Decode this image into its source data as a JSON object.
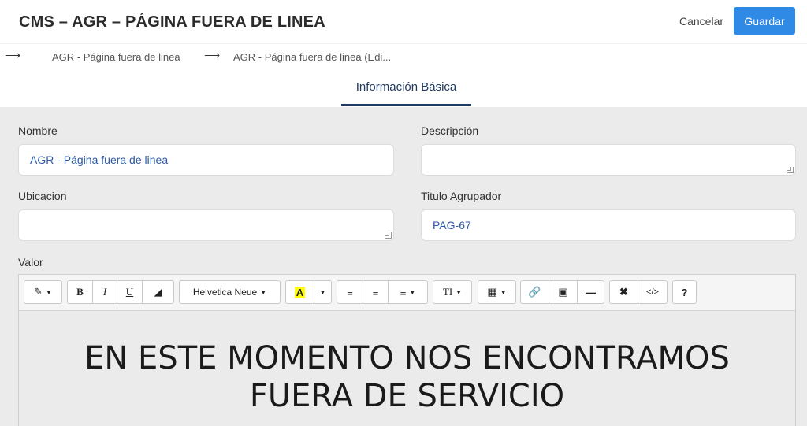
{
  "header": {
    "title": "CMS – AGR – PÁGINA FUERA DE LINEA",
    "cancel_label": "Cancelar",
    "save_label": "Guardar"
  },
  "breadcrumb": {
    "items": [
      "AGR - Página fuera de linea",
      "AGR - Página fuera de linea (Edi..."
    ],
    "separator_icon": "arrow-right-icon"
  },
  "tabs": [
    {
      "label": "Información Básica",
      "active": true
    }
  ],
  "form": {
    "nombre": {
      "label": "Nombre",
      "value": "AGR - Página fuera de linea"
    },
    "descripcion": {
      "label": "Descripción",
      "value": ""
    },
    "ubicacion": {
      "label": "Ubicacion",
      "value": ""
    },
    "titulo_agrupador": {
      "label": "Titulo Agrupador",
      "value": "PAG-67"
    },
    "valor": {
      "label": "Valor"
    }
  },
  "editor": {
    "font_name": "Helvetica Neue",
    "content_lines": [
      "EN ESTE MOMENTO NOS ENCONTRAMOS",
      "FUERA DE SERVICIO"
    ],
    "toolbar_icons": [
      "magic-wand-icon",
      "bold-icon",
      "italic-icon",
      "underline-icon",
      "eraser-icon",
      "font-family-dropdown",
      "highlight-color-icon",
      "unordered-list-icon",
      "ordered-list-icon",
      "align-icon",
      "text-height-icon",
      "table-icon",
      "link-icon",
      "image-icon",
      "horizontal-rule-icon",
      "fullscreen-icon",
      "code-view-icon",
      "help-icon"
    ]
  },
  "colors": {
    "accent": "#2f8ae6",
    "tab_active": "#213a63",
    "field_value": "#2e5aa6",
    "highlight": "#ffff00"
  }
}
